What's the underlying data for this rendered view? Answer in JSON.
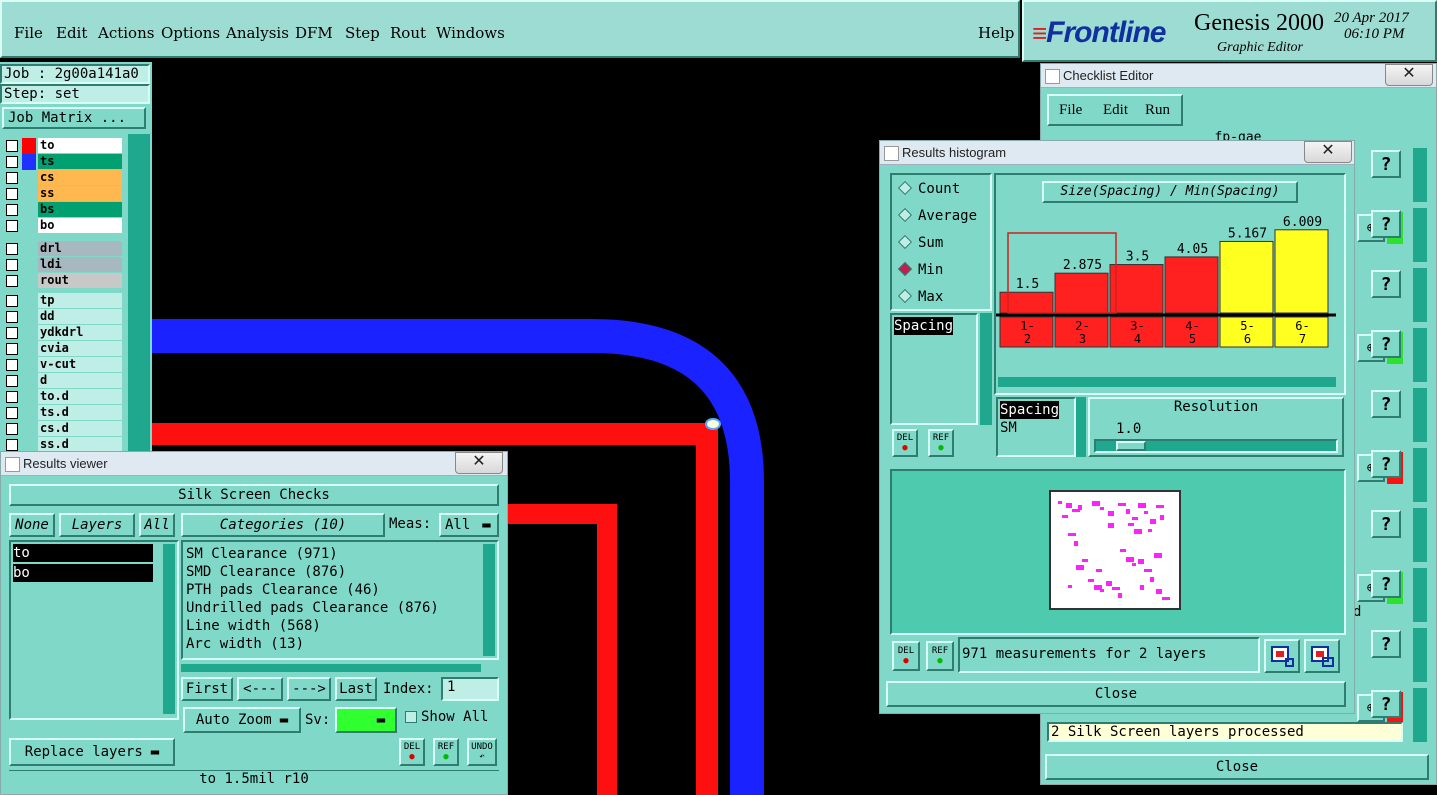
{
  "menu": {
    "items": [
      "File",
      "Edit",
      "Actions",
      "Options",
      "Analysis",
      "DFM",
      "Step",
      "Rout",
      "Windows"
    ],
    "help": "Help"
  },
  "brand": {
    "logo": "Frontline",
    "product": "Genesis 2000",
    "subtitle": "Graphic Editor",
    "date": "20 Apr 2017",
    "time": "06:10 PM"
  },
  "job": {
    "job_label": "Job : 2g00a141a0",
    "step_label": "Step: set",
    "matrix_button": "Job Matrix ..."
  },
  "layers": {
    "group1": [
      {
        "name": "to",
        "color": "#ffffff",
        "swatch": "#ff0000"
      },
      {
        "name": "ts",
        "color": "#00a070",
        "swatch": "#2030ff"
      },
      {
        "name": "cs",
        "color": "#ffb850",
        "swatch": ""
      },
      {
        "name": "ss",
        "color": "#ffb850",
        "swatch": ""
      },
      {
        "name": "bs",
        "color": "#00a070",
        "swatch": ""
      },
      {
        "name": "bo",
        "color": "#ffffff",
        "swatch": ""
      }
    ],
    "group2": [
      {
        "name": "drl",
        "color": "#a8b8c0"
      },
      {
        "name": "ldi",
        "color": "#a8b8c0"
      },
      {
        "name": "rout",
        "color": "#c8c8c8"
      }
    ],
    "group3": [
      {
        "name": "tp"
      },
      {
        "name": "dd"
      },
      {
        "name": "ydkdrl"
      },
      {
        "name": "cvia"
      },
      {
        "name": "v-cut"
      },
      {
        "name": "d"
      },
      {
        "name": "to.d"
      },
      {
        "name": "ts.d"
      },
      {
        "name": "cs.d"
      },
      {
        "name": "ss.d"
      }
    ]
  },
  "results_viewer": {
    "title": "Results viewer",
    "header": "Silk Screen Checks",
    "none": "None",
    "layers": "Layers",
    "all": "All",
    "layer_list": [
      "to",
      "bo"
    ],
    "categories_label": "Categories (10)",
    "meas_label": "Meas:",
    "meas_value": "All",
    "categories": [
      "SM Clearance (971)",
      "SMD Clearance (876)",
      "PTH pads Clearance (46)",
      "Undrilled pads Clearance (876)",
      "Line width (568)",
      "Arc width (13)"
    ],
    "first": "First",
    "prev": "<---",
    "next": "--->",
    "last": "Last",
    "index_label": "Index:",
    "index_value": "1",
    "auto_zoom": "Auto Zoom",
    "sv_label": "Sv:",
    "show_all": "Show All",
    "replace_layers": "Replace layers",
    "del": "DEL",
    "ref": "REF",
    "undo": "UNDO",
    "status": "to 1.5mil  r10"
  },
  "histogram": {
    "title": "Results histogram",
    "options": [
      "Count",
      "Average",
      "Sum",
      "Min",
      "Max"
    ],
    "selected": "Min",
    "measure_label": "Spacing",
    "chart_title": "Size(Spacing) / Min(Spacing)",
    "list2": [
      "Spacing",
      "SM"
    ],
    "resolution_label": "Resolution",
    "resolution_value": "1.0",
    "status": "971 measurements for 2 layers",
    "close": "Close",
    "del": "DEL",
    "ref": "REF"
  },
  "chart_data": {
    "type": "bar",
    "title": "Size(Spacing) / Min(Spacing)",
    "categories": [
      "1-2",
      "2-3",
      "3-4",
      "4-5",
      "5-6",
      "6-7"
    ],
    "values": [
      1.5,
      2.875,
      3.5,
      4.05,
      5.167,
      6.009
    ],
    "colors": [
      "#ff2020",
      "#ff2020",
      "#ff2020",
      "#ff2020",
      "#ffff20",
      "#ffff20"
    ],
    "ylim": [
      0,
      6.5
    ]
  },
  "checklist": {
    "title": "Checklist Editor",
    "menu": [
      "File",
      "Edit",
      "Run"
    ],
    "name": "fp-gae",
    "status": "2 Silk Screen layers processed",
    "close": "Close",
    "side_text": "d"
  }
}
